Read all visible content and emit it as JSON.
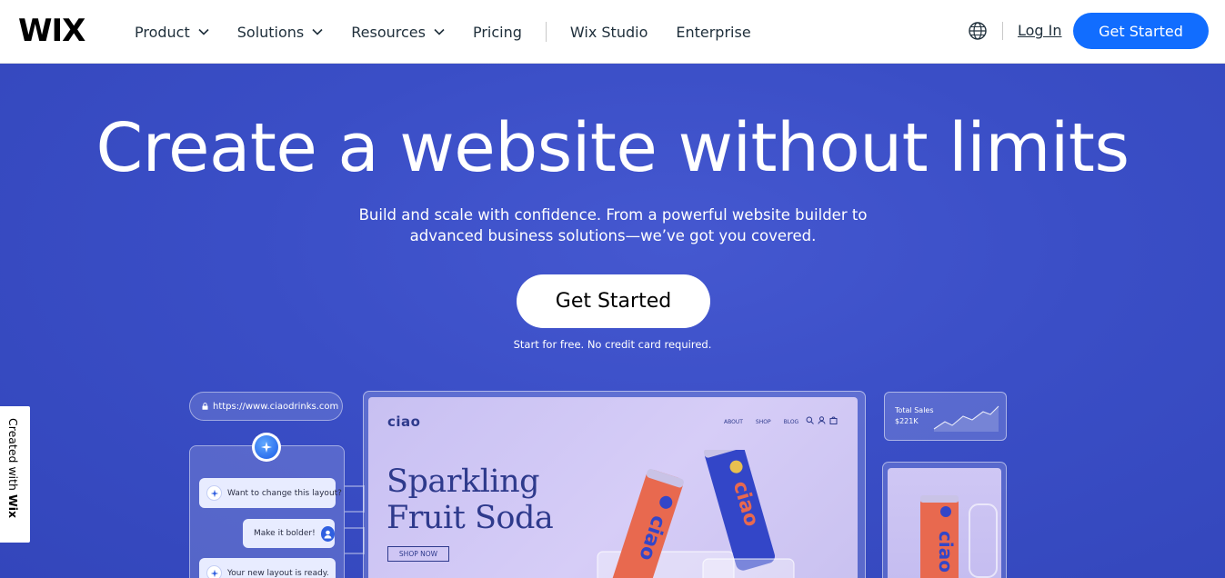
{
  "header": {
    "logo": "WIX",
    "nav": [
      {
        "label": "Product",
        "dropdown": true
      },
      {
        "label": "Solutions",
        "dropdown": true
      },
      {
        "label": "Resources",
        "dropdown": true
      },
      {
        "label": "Pricing",
        "dropdown": false
      },
      {
        "label": "Wix Studio",
        "dropdown": false
      },
      {
        "label": "Enterprise",
        "dropdown": false
      }
    ],
    "login": "Log In",
    "cta": "Get Started",
    "icons": {
      "language": "globe-icon",
      "chevron": "chevron-down-icon"
    }
  },
  "hero": {
    "title": "Create a website without limits",
    "subtitle_line1": "Build and scale with confidence. From a powerful website builder to",
    "subtitle_line2": "advanced business solutions—we’ve got you covered.",
    "cta": "Get Started",
    "note": "Start for free. No credit card required."
  },
  "badge": {
    "prefix": "Created with ",
    "brand": "Wix"
  },
  "preview": {
    "url": "https://www.ciaodrinks.com",
    "chat": [
      {
        "from": "ai",
        "text": "Want to change this layout?"
      },
      {
        "from": "user",
        "text": "Make it bolder!"
      },
      {
        "from": "ai",
        "text": "Your new layout is ready."
      }
    ],
    "site": {
      "logo": "ciao",
      "nav": [
        "ABOUT",
        "SHOP",
        "BLOG"
      ],
      "title_line1": "Sparkling",
      "title_line2": "Fruit Soda",
      "button": "SHOP NOW"
    },
    "stats": {
      "label": "Total Sales",
      "value": "$221K"
    }
  },
  "colors": {
    "accent": "#116dff",
    "hero_bg": "#3a4fc4",
    "site_ink": "#2e3a8c",
    "can_orange": "#e8694f",
    "can_blue": "#3346c8"
  }
}
